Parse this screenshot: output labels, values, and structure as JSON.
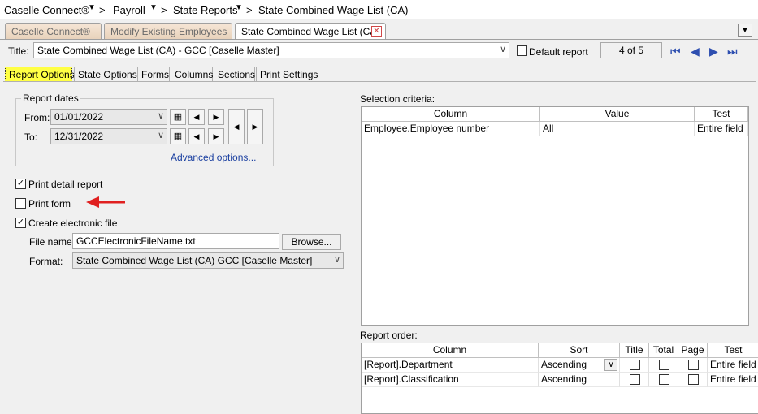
{
  "breadcrumb": {
    "root": "Caselle Connect®",
    "payroll": "Payroll",
    "state_reports": "State Reports",
    "current": "State Combined Wage List (CA)"
  },
  "tabs": [
    {
      "label": "Caselle Connect®"
    },
    {
      "label": "Modify Existing Employees"
    },
    {
      "label": "State Combined Wage List (CA)"
    }
  ],
  "header": {
    "title_label": "Title:",
    "title_value": "State Combined Wage List (CA) - GCC [Caselle Master]",
    "default_report_label": "Default report",
    "record_position": "4 of 5"
  },
  "subtabs": [
    "Report Options",
    "State Options",
    "Forms",
    "Columns",
    "Sections",
    "Print Settings"
  ],
  "report_dates": {
    "group_label": "Report dates",
    "from_label": "From:",
    "from_value": "01/01/2022",
    "to_label": "To:",
    "to_value": "12/31/2022",
    "advanced_link": "Advanced options..."
  },
  "options": {
    "print_detail_label": "Print detail report",
    "print_detail_checked": true,
    "print_form_label": "Print form",
    "print_form_checked": false,
    "create_file_label": "Create electronic file",
    "create_file_checked": true,
    "file_name_label": "File name:",
    "file_name_value": "GCCElectronicFileName.txt",
    "browse_label": "Browse...",
    "format_label": "Format:",
    "format_value": "State Combined Wage List (CA) GCC [Caselle Master]"
  },
  "selection_criteria": {
    "label": "Selection criteria:",
    "columns": [
      "Column",
      "Value",
      "Test"
    ],
    "rows": [
      {
        "column": "Employee.Employee number",
        "value": "All",
        "test": "Entire field"
      }
    ]
  },
  "report_order": {
    "label": "Report order:",
    "columns": [
      "Column",
      "Sort",
      "Title",
      "Total",
      "Page",
      "Test"
    ],
    "rows": [
      {
        "column": "[Report].Department",
        "sort": "Ascending",
        "test": "Entire field"
      },
      {
        "column": "[Report].Classification",
        "sort": "Ascending",
        "test": "Entire field"
      }
    ]
  },
  "colors": {
    "active_subtab": "#ffff44",
    "annotation_arrow": "#e02020",
    "link": "#1a3fa0"
  }
}
